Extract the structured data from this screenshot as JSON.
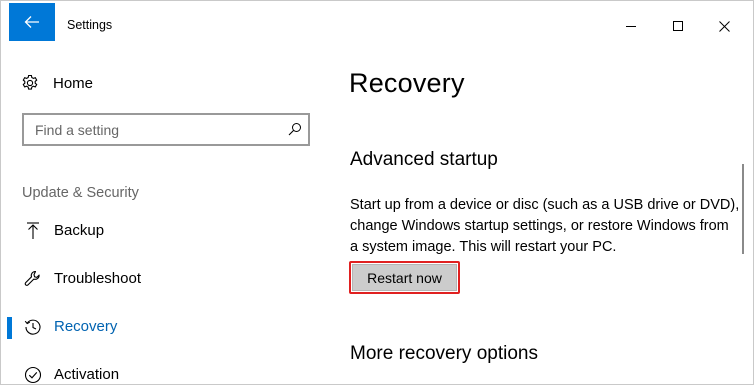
{
  "window": {
    "title": "Settings",
    "accent_color": "#0078d7"
  },
  "icons": {
    "back": "back-arrow-icon",
    "minimize": "minimize-icon",
    "maximize": "maximize-icon",
    "close": "close-icon",
    "home": "gear-icon",
    "search": "search-icon",
    "backup": "upload-arrow-icon",
    "troubleshoot": "wrench-icon",
    "recovery": "history-icon",
    "activation": "check-circle-icon"
  },
  "sidebar": {
    "home_label": "Home",
    "search": {
      "placeholder": "Find a setting",
      "value": ""
    },
    "group_label": "Update & Security",
    "items": [
      {
        "label": "Backup",
        "active": false
      },
      {
        "label": "Troubleshoot",
        "active": false
      },
      {
        "label": "Recovery",
        "active": true
      },
      {
        "label": "Activation",
        "active": false
      }
    ]
  },
  "main": {
    "title": "Recovery",
    "advanced_startup": {
      "heading": "Advanced startup",
      "description": "Start up from a device or disc (such as a USB drive or DVD), change Windows startup settings, or restore Windows from a system image. This will restart your PC.",
      "button_label": "Restart now",
      "highlight_color": "#e02020"
    },
    "more_options_heading": "More recovery options"
  }
}
